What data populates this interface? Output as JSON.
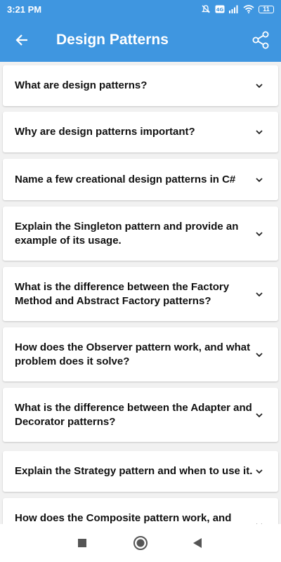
{
  "status_bar": {
    "time": "3:21 PM",
    "battery": "11",
    "icons": [
      "mute-icon",
      "volte-icon",
      "signal-icon",
      "wifi-icon",
      "battery-icon"
    ]
  },
  "app_bar": {
    "title": "Design Patterns",
    "back_icon": "arrow-left-icon",
    "share_icon": "share-icon"
  },
  "questions": [
    "What are design patterns?",
    "Why are design patterns important?",
    "Name a few creational design patterns in C#",
    "Explain the Singleton pattern and provide an example of its usage.",
    "What is the difference between the Factory Method and Abstract Factory patterns?",
    "How does the Observer pattern work, and what problem does it solve?",
    "What is the difference between the Adapter and Decorator patterns?",
    "Explain the Strategy pattern and when to use it.",
    "How does the Composite pattern work, and"
  ],
  "nav_bar": {
    "icons": [
      "recents-square-icon",
      "home-circle-icon",
      "back-triangle-icon"
    ]
  },
  "colors": {
    "primary": "#3f96e0",
    "background": "#f1f1f1",
    "card": "#ffffff",
    "text": "#111111"
  }
}
